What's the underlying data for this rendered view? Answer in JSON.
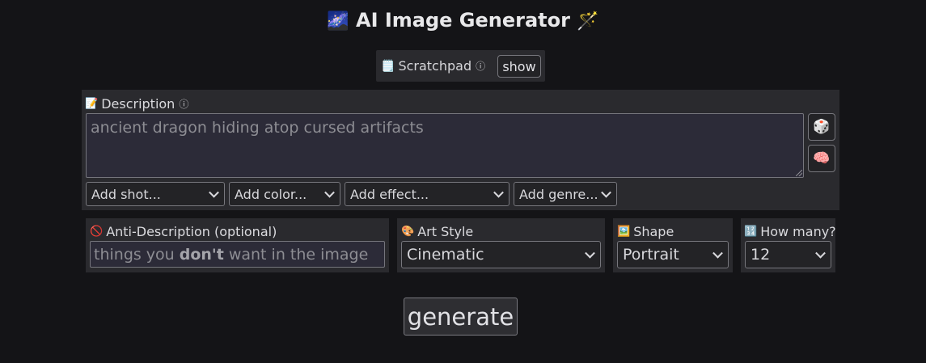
{
  "header": {
    "title": "AI Image Generator",
    "left_emoji": "🌌",
    "right_emoji": "🪄"
  },
  "scratchpad": {
    "emoji": "🗒️",
    "label": "Scratchpad",
    "info_icon": "ⓘ",
    "show_label": "show"
  },
  "description": {
    "emoji": "📝",
    "label": "Description",
    "info_icon": "ⓘ",
    "placeholder": "ancient dragon hiding atop cursed artifacts",
    "dice_icon": "🎲",
    "brain_icon": "🧠",
    "dropdowns": [
      "Add shot...",
      "Add color...",
      "Add effect...",
      "Add genre..."
    ]
  },
  "anti_description": {
    "emoji": "🚫",
    "label": "Anti-Description (optional)",
    "placeholder_before": "things you",
    "placeholder_bold": "don't",
    "placeholder_after": "want in the image"
  },
  "art_style": {
    "emoji": "🎨",
    "label": "Art Style",
    "value": "Cinematic"
  },
  "shape": {
    "emoji": "🖼️",
    "label": "Shape",
    "value": "Portrait"
  },
  "how_many": {
    "emoji": "🔢",
    "label": "How many?",
    "value": "12"
  },
  "generate_label": "generate",
  "colors": {
    "background": "#141417",
    "panel": "#2a2a2e",
    "input": "#2c2b38",
    "border": "#77777d"
  }
}
